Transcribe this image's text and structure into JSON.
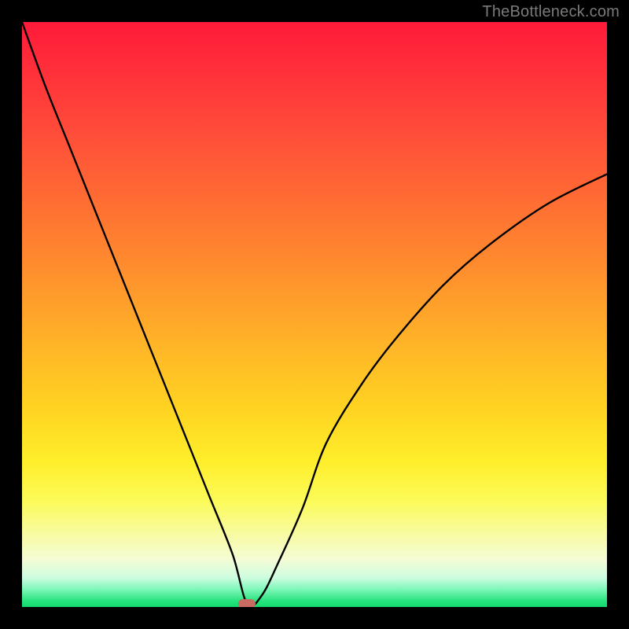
{
  "watermark": "TheBottleneck.com",
  "colors": {
    "frame": "#000000",
    "curve": "#000000",
    "marker": "#c96b60"
  },
  "chart_data": {
    "type": "line",
    "title": "",
    "xlabel": "",
    "ylabel": "",
    "xlim": [
      0,
      100
    ],
    "ylim": [
      0,
      100
    ],
    "grid": false,
    "legend": false,
    "background": "vertical-gradient red→orange→yellow→green",
    "series": [
      {
        "name": "bottleneck-curve",
        "x": [
          0,
          4,
          8,
          12,
          16,
          20,
          24,
          28,
          32,
          36,
          38.5,
          41,
          44,
          48,
          52,
          58,
          64,
          72,
          80,
          90,
          100
        ],
        "y": [
          100,
          89,
          79,
          69,
          59,
          49,
          39,
          29,
          19,
          9,
          0.5,
          2,
          8,
          17,
          28,
          38,
          46,
          55,
          62,
          69,
          74
        ]
      }
    ],
    "marker": {
      "x": 38.5,
      "y": 0.5
    }
  }
}
